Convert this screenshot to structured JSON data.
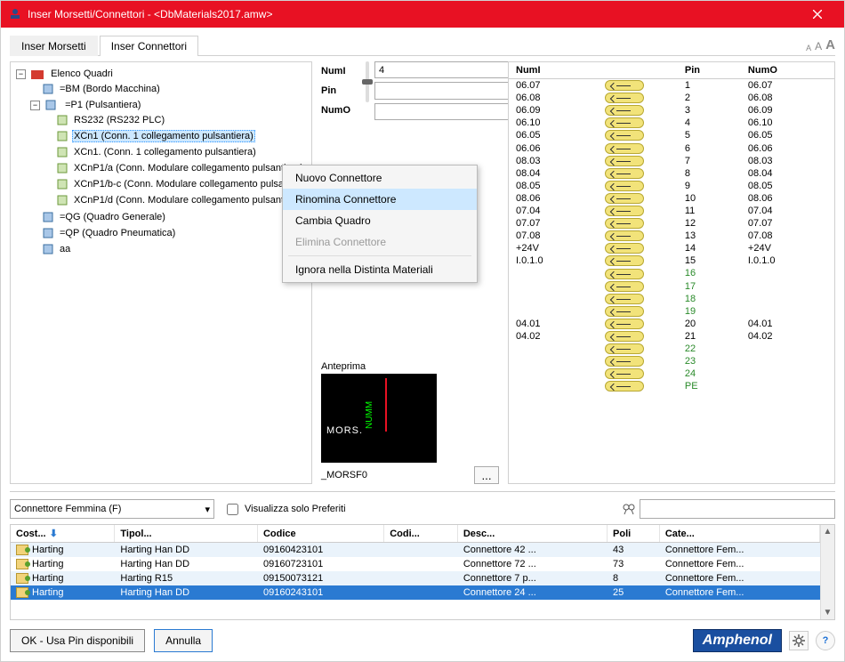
{
  "window": {
    "title": "Inser Morsetti/Connettori - <DbMaterials2017.amw>"
  },
  "tabs": {
    "morsetti": "Inser Morsetti",
    "connettori": "Inser Connettori"
  },
  "tree": {
    "root": "Elenco Quadri",
    "bm": "=BM (Bordo Macchina)",
    "p1": "=P1 (Pulsantiera)",
    "rs232": "RS232 (RS232 PLC)",
    "xcn1a": "XCn1 (Conn. 1 collegamento pulsantiera)",
    "xcn1b": "XCn1. (Conn. 1 collegamento pulsantiera)",
    "xcnp1a": "XCnP1/a (Conn. Modulare collegamento pulsantiera)",
    "xcnp1bc": "XCnP1/b-c (Conn. Modulare collegamento pulsantiera)",
    "xcnp1d": "XCnP1/d (Conn. Modulare collegamento pulsantiera)",
    "qg": "=QG (Quadro Generale)",
    "qp": "=QP (Quadro Pneumatica)",
    "aa": "aa"
  },
  "context_menu": {
    "nuovo": "Nuovo Connettore",
    "rinomina": "Rinomina Connettore",
    "cambia": "Cambia Quadro",
    "elimina": "Elimina Connettore",
    "ignora": "Ignora nella Distinta Materiali"
  },
  "fields": {
    "numi_label": "NumI",
    "numi_value": "4",
    "pin_label": "Pin",
    "pin_value": "",
    "numo_label": "NumO",
    "numo_value": ""
  },
  "preview": {
    "title": "Anteprima",
    "mors": "MORS.",
    "numm": "NUMM",
    "name": "_MORSF0",
    "browse": "..."
  },
  "pins": {
    "headers": {
      "numi": "NumI",
      "pin": "Pin",
      "numo": "NumO"
    },
    "rows": [
      {
        "numi": "06.07",
        "pin": "1",
        "numo": "06.07",
        "g": false
      },
      {
        "numi": "06.08",
        "pin": "2",
        "numo": "06.08",
        "g": false
      },
      {
        "numi": "06.09",
        "pin": "3",
        "numo": "06.09",
        "g": false
      },
      {
        "numi": "06.10",
        "pin": "4",
        "numo": "06.10",
        "g": false
      },
      {
        "numi": "06.05",
        "pin": "5",
        "numo": "06.05",
        "g": false
      },
      {
        "numi": "06.06",
        "pin": "6",
        "numo": "06.06",
        "g": false
      },
      {
        "numi": "08.03",
        "pin": "7",
        "numo": "08.03",
        "g": false
      },
      {
        "numi": "08.04",
        "pin": "8",
        "numo": "08.04",
        "g": false
      },
      {
        "numi": "08.05",
        "pin": "9",
        "numo": "08.05",
        "g": false
      },
      {
        "numi": "08.06",
        "pin": "10",
        "numo": "08.06",
        "g": false
      },
      {
        "numi": "07.04",
        "pin": "11",
        "numo": "07.04",
        "g": false
      },
      {
        "numi": "07.07",
        "pin": "12",
        "numo": "07.07",
        "g": false
      },
      {
        "numi": "07.08",
        "pin": "13",
        "numo": "07.08",
        "g": false
      },
      {
        "numi": "+24V",
        "pin": "14",
        "numo": "+24V",
        "g": false
      },
      {
        "numi": "I.0.1.0",
        "pin": "15",
        "numo": "I.0.1.0",
        "g": false
      },
      {
        "numi": "",
        "pin": "16",
        "numo": "",
        "g": true
      },
      {
        "numi": "",
        "pin": "17",
        "numo": "",
        "g": true
      },
      {
        "numi": "",
        "pin": "18",
        "numo": "",
        "g": true
      },
      {
        "numi": "",
        "pin": "19",
        "numo": "",
        "g": true
      },
      {
        "numi": "04.01",
        "pin": "20",
        "numo": "04.01",
        "g": false
      },
      {
        "numi": "04.02",
        "pin": "21",
        "numo": "04.02",
        "g": false
      },
      {
        "numi": "",
        "pin": "22",
        "numo": "",
        "g": true
      },
      {
        "numi": "",
        "pin": "23",
        "numo": "",
        "g": true
      },
      {
        "numi": "",
        "pin": "24",
        "numo": "",
        "g": true
      },
      {
        "numi": "",
        "pin": "PE",
        "numo": "",
        "g": true
      }
    ]
  },
  "filter": {
    "combo": "Connettore Femmina (F)",
    "favorites": "Visualizza solo Preferiti"
  },
  "grid": {
    "headers": {
      "cost": "Cost...",
      "tipo": "Tipol...",
      "codice": "Codice",
      "codi": "Codi...",
      "desc": "Desc...",
      "poli": "Poli",
      "cate": "Cate..."
    },
    "rows": [
      {
        "cost": "Harting",
        "tipo": "Harting Han DD",
        "codice": "09160423101",
        "codi": "",
        "desc": "Connettore 42 ...",
        "poli": "43",
        "cate": "Connettore Fem...",
        "cls": "odd"
      },
      {
        "cost": "Harting",
        "tipo": "Harting Han DD",
        "codice": "09160723101",
        "codi": "",
        "desc": "Connettore 72 ...",
        "poli": "73",
        "cate": "Connettore Fem...",
        "cls": "even"
      },
      {
        "cost": "Harting",
        "tipo": "Harting R15",
        "codice": "09150073121",
        "codi": "",
        "desc": "Connettore 7 p...",
        "poli": "8",
        "cate": "Connettore Fem...",
        "cls": "odd"
      },
      {
        "cost": "Harting",
        "tipo": "Harting Han DD",
        "codice": "09160243101",
        "codi": "",
        "desc": "Connettore 24 ...",
        "poli": "25",
        "cate": "Connettore Fem...",
        "cls": "sel"
      }
    ]
  },
  "footer": {
    "ok": "OK - Usa Pin disponibili",
    "cancel": "Annulla",
    "brand": "Amphenol"
  }
}
